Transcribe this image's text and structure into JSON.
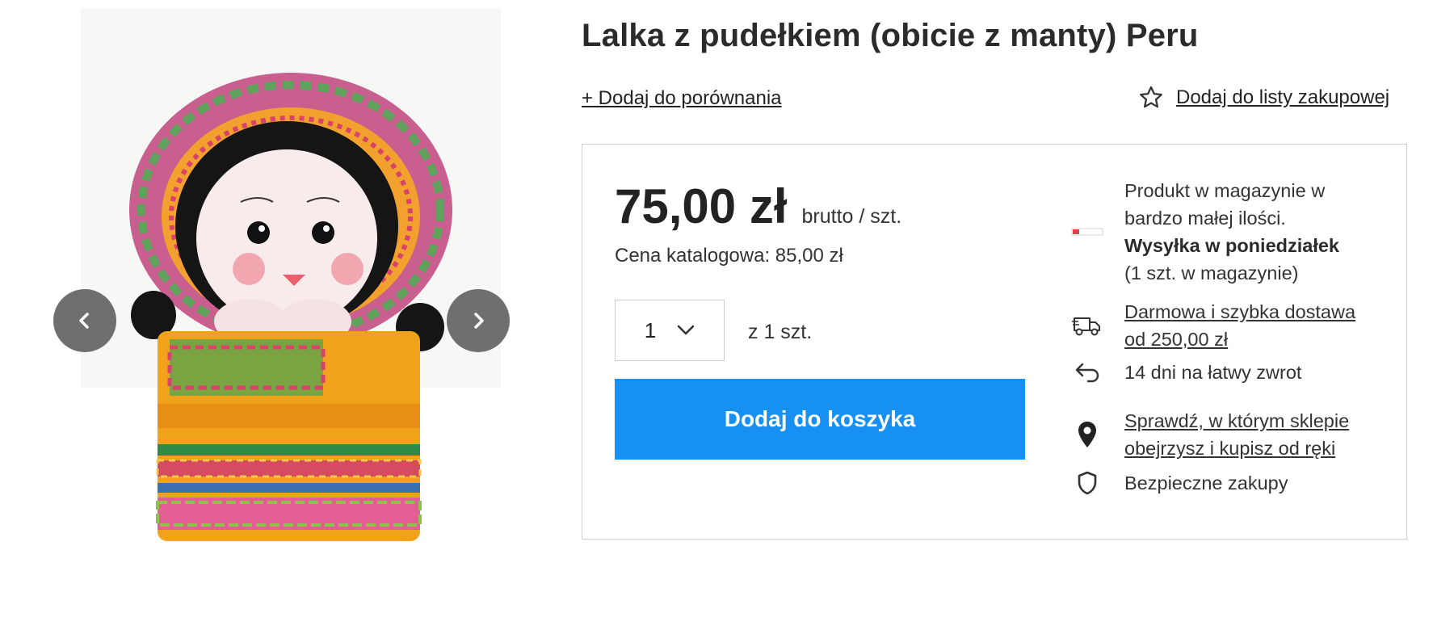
{
  "product": {
    "title": "Lalka z pudełkiem (obicie z manty) Peru",
    "image_alt": "Peruvian doll in a woven box"
  },
  "actions": {
    "compare_label": "+ Dodaj do porównania",
    "wishlist_label": "Dodaj do listy zakupowej"
  },
  "gallery": {
    "prev_icon": "chevron-left-icon",
    "next_icon": "chevron-right-icon",
    "button_color": "#6f6f6f"
  },
  "pricing": {
    "price": "75,00 zł",
    "unit": "brutto / szt.",
    "catalog_price": "Cena katalogowa: 85,00 zł"
  },
  "quantity": {
    "selected": "1",
    "available": "z 1 szt."
  },
  "cart": {
    "button_label": "Dodaj do koszyka",
    "button_color": "#1690f2"
  },
  "stock": {
    "status_line1": "Produkt w magazynie w",
    "status_line2": "bardzo małej ilości.",
    "shipping": "Wysyłka w poniedziałek",
    "count": "(1 szt. w magazynie)",
    "level_color": "#e0424b"
  },
  "benefits": {
    "delivery_line1": "Darmowa i szybka dostawa",
    "delivery_line2": "od 250,00 zł",
    "returns": "14 dni na łatwy zwrot",
    "store_line1": "Sprawdź, w którym sklepie",
    "store_line2": "obejrzysz i kupisz od ręki",
    "secure": "Bezpieczne zakupy"
  }
}
